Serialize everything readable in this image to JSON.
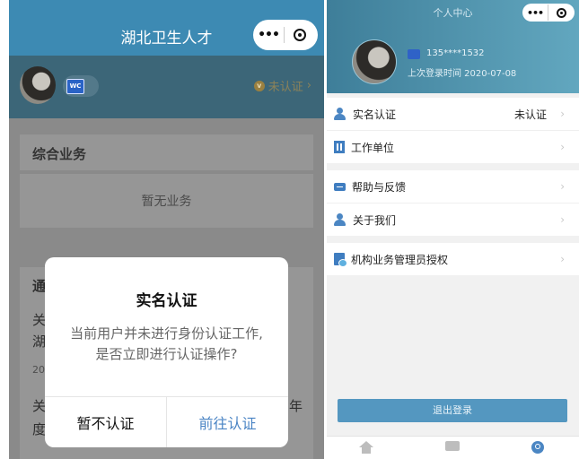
{
  "left_screen": {
    "title": "湖北卫生人才",
    "capsule": {
      "menu_icon": "more-dots-icon",
      "close_icon": "target-icon"
    },
    "profile": {
      "badge_text": "WC",
      "cert_status": "未认证",
      "cert_arrow": "›"
    },
    "card_business": {
      "title": "综合业务",
      "empty_text": "暂无业务"
    },
    "bg_fragments": {
      "notice_char": "通",
      "row1_char": "关",
      "row1b_char": "湖",
      "date1": "20",
      "row2_char": "关",
      "row2b_char": "度",
      "row2_tail": "年"
    },
    "dialog": {
      "title": "实名认证",
      "message_line1": "当前用户并未进行身份认证工作,",
      "message_line2": "是否立即进行认证操作?",
      "cancel_label": "暂不认证",
      "confirm_label": "前往认证"
    }
  },
  "right_screen": {
    "title": "个人中心",
    "phone": "135****1532",
    "last_login": "上次登录时间 2020-07-08",
    "menu_group1": [
      {
        "label": "实名认证",
        "value": "未认证",
        "icon": "person-icon"
      },
      {
        "label": "工作单位",
        "value": "",
        "icon": "building-icon"
      }
    ],
    "menu_group2": [
      {
        "label": "帮助与反馈",
        "value": "",
        "icon": "chat-icon"
      },
      {
        "label": "关于我们",
        "value": "",
        "icon": "person-icon"
      }
    ],
    "menu_group3": [
      {
        "label": "机构业务管理员授权",
        "value": "",
        "icon": "doc-auth-icon"
      }
    ],
    "chevron": "›",
    "logout_label": "退出登录",
    "tabbar": [
      "home-icon",
      "message-icon",
      "profile-icon"
    ]
  },
  "colors": {
    "nav_blue": "#3d8ab3",
    "dialog_accent": "#4a84c4",
    "header_gradient_start": "#3e7e99",
    "logout_button": "#5497c0"
  }
}
